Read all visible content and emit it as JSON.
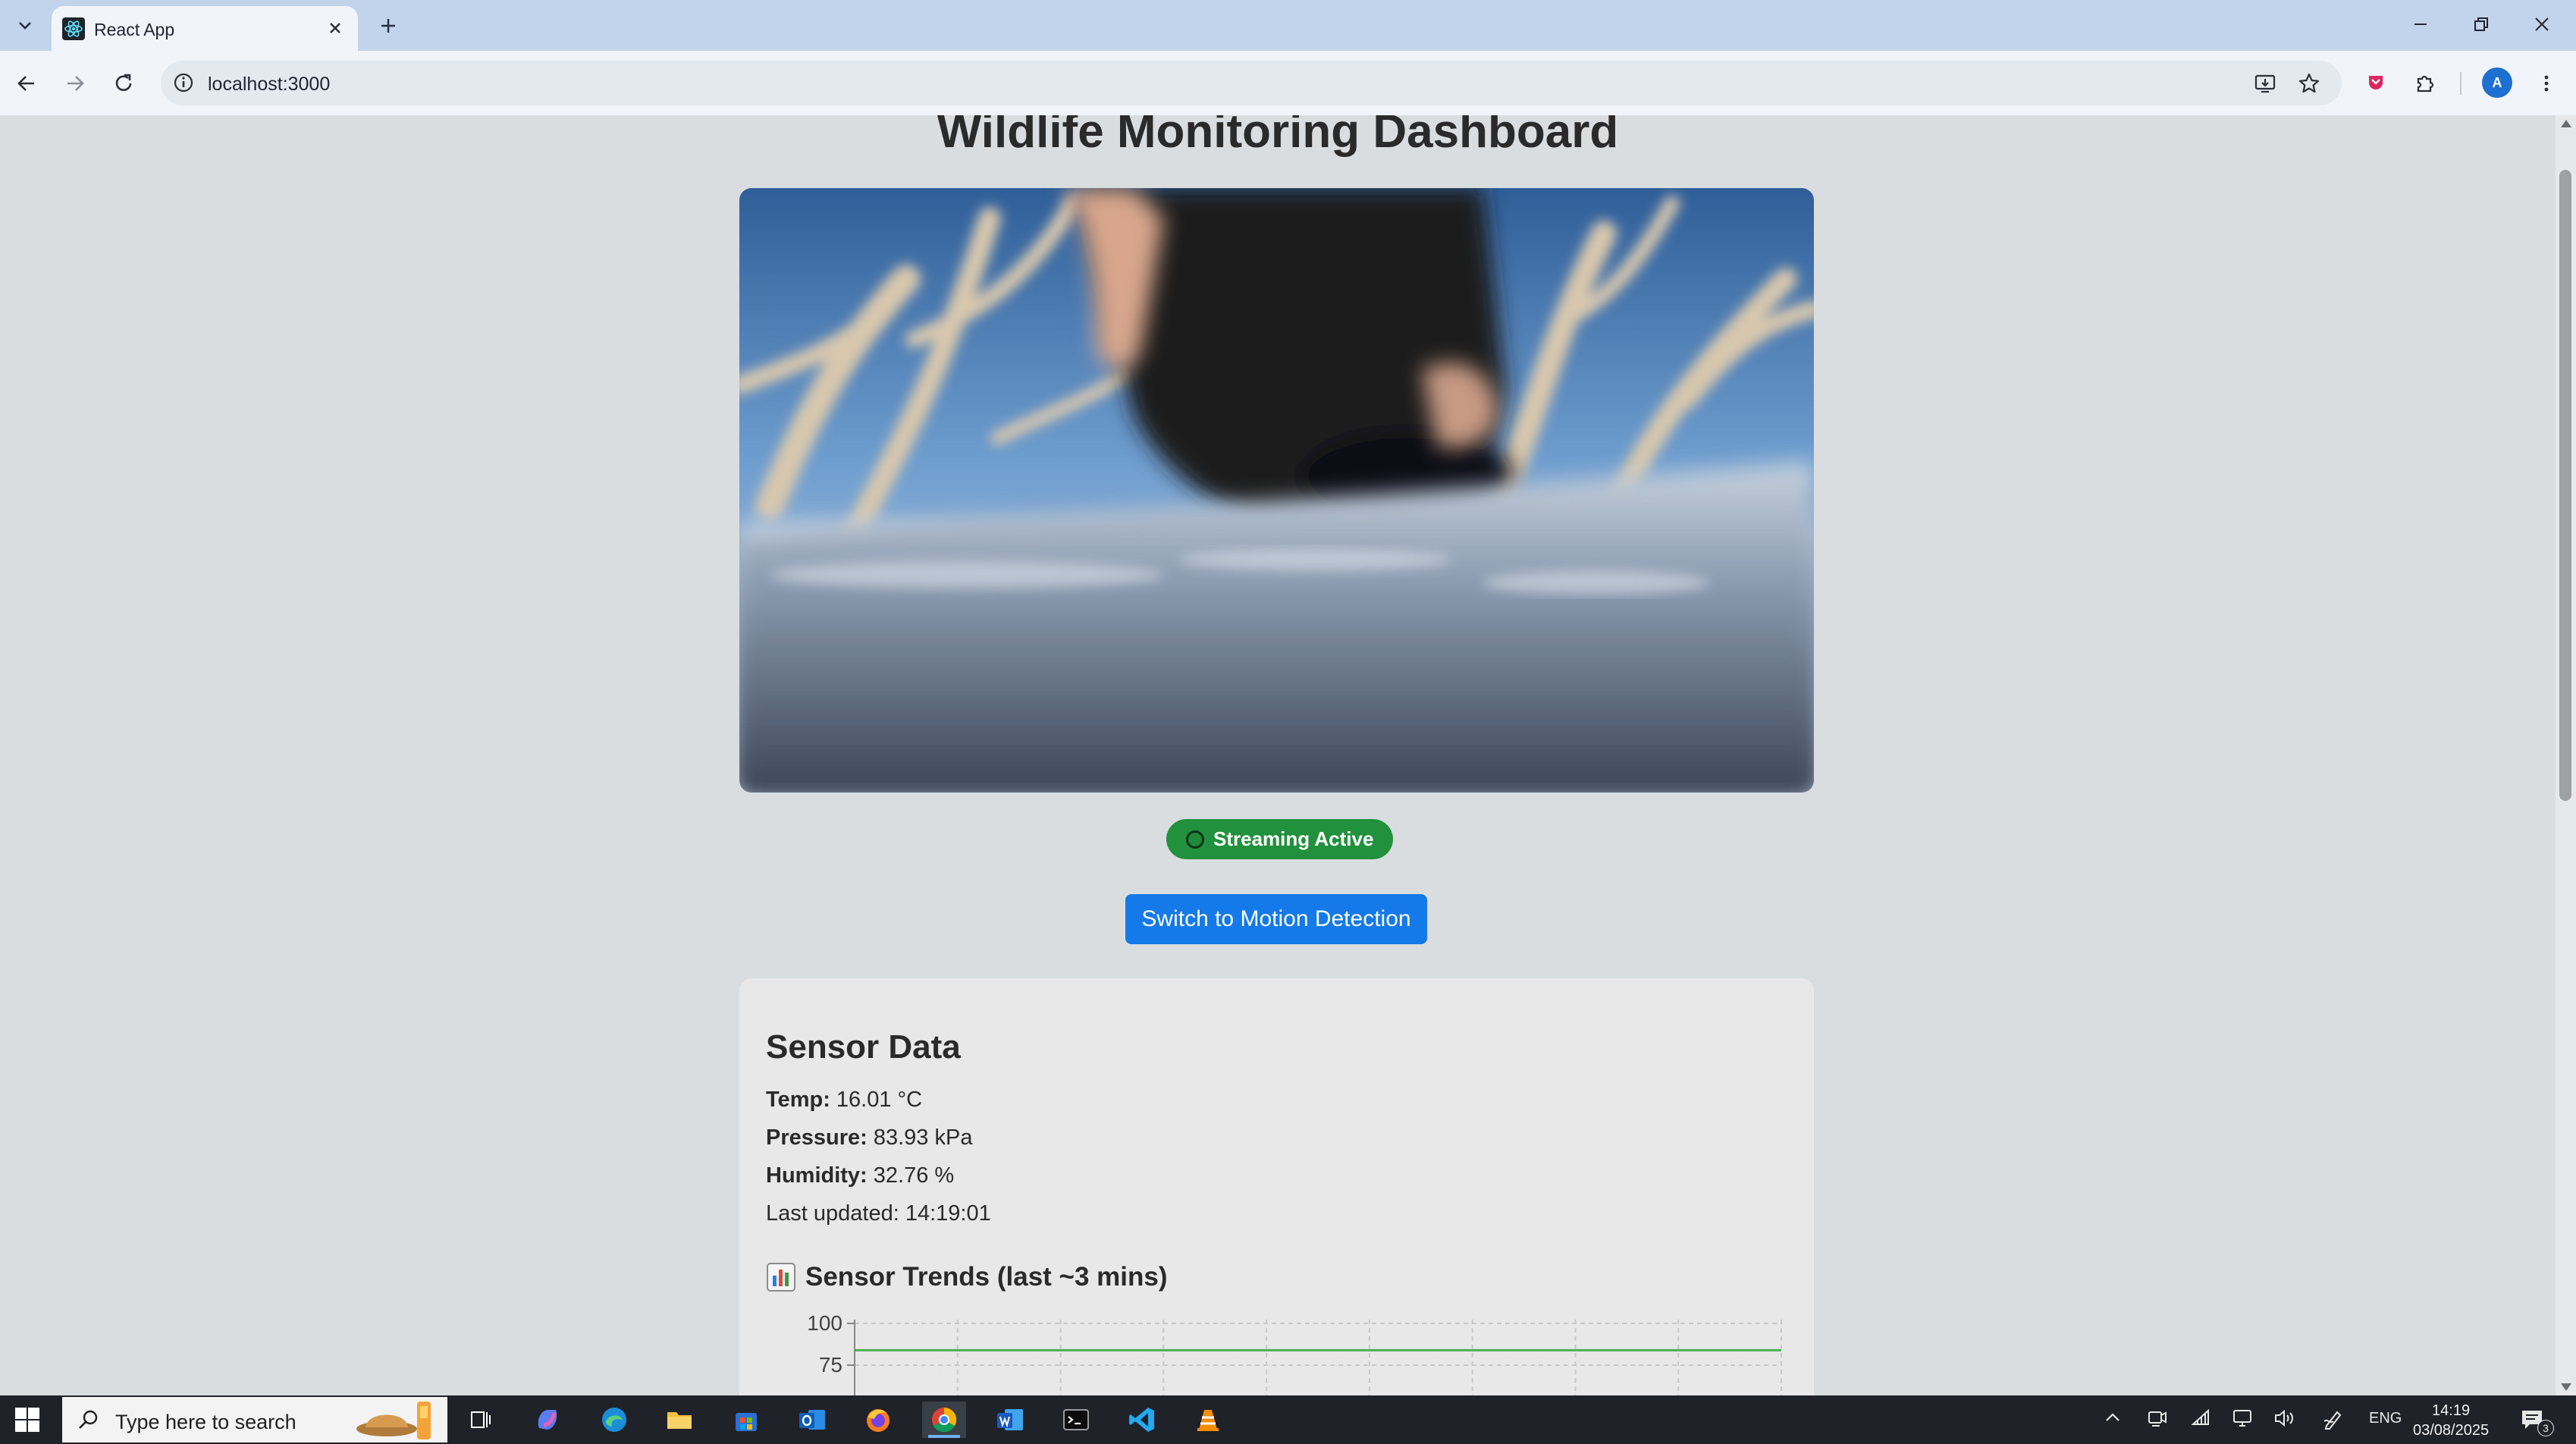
{
  "browser": {
    "tab_title": "React App",
    "url": "localhost:3000",
    "profile_initial": "A"
  },
  "page": {
    "title": "Wildlife Monitoring Dashboard",
    "status": "Streaming Active",
    "mode_button": "Switch to Motion Detection"
  },
  "sensor": {
    "title": "Sensor Data",
    "temp_label": "Temp:",
    "temp_value": " 16.01 °C",
    "pressure_label": "Pressure:",
    "pressure_value": " 83.93 kPa",
    "humidity_label": "Humidity:",
    "humidity_value": " 32.76 %",
    "last_updated": "Last updated: 14:19:01",
    "trends_title": "Sensor Trends (last ~3 mins)"
  },
  "chart_data": {
    "type": "line",
    "y_ticks": [
      "100",
      "75"
    ],
    "series": [
      {
        "values": [
          83.93,
          83.93,
          83.93,
          83.93,
          83.93,
          83.93,
          83.93,
          83.93,
          83.93,
          83.93
        ],
        "color": "#4caf50"
      }
    ]
  },
  "taskbar": {
    "search_placeholder": "Type here to search",
    "language": "ENG",
    "time": "14:19",
    "date": "03/08/2025",
    "notification_count": "3"
  },
  "icons": [
    "chevron-down-icon",
    "react-icon",
    "close-icon",
    "plus-icon",
    "minimize-icon",
    "restore-icon",
    "back-icon",
    "forward-icon",
    "reload-icon",
    "info-icon",
    "install-icon",
    "star-icon",
    "extension-icon",
    "puzzle-icon",
    "menu-icon",
    "windows-icon",
    "search-icon",
    "chart-icon"
  ]
}
